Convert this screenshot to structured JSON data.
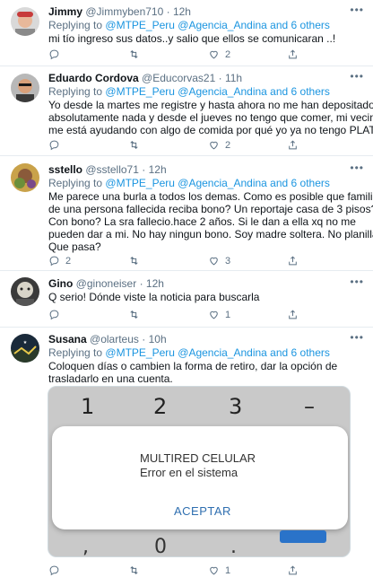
{
  "colors": {
    "link": "#1b95e0",
    "secondary_text": "#5b7083",
    "divider": "#e6ecf0",
    "dialog_button": "#2f6fb0"
  },
  "tweets": [
    {
      "name": "Jimmy",
      "handle": "@Jimmyben710",
      "time": "12h",
      "replying_prefix": "Replying to",
      "replying_links": "@MTPE_Peru @Agencia_Andina and 6 others",
      "text_lines": [
        "mi tío ingreso sus datos..y salio que ellos se comunicaran  ..!"
      ],
      "counts": {
        "reply": "",
        "retweet": "",
        "like": "2"
      }
    },
    {
      "name": "Eduardo Cordova",
      "handle": "@Educorvas21",
      "time": "11h",
      "replying_prefix": "Replying to",
      "replying_links": "@MTPE_Peru @Agencia_Andina and 6 others",
      "text_lines": [
        "Yo desde la martes me registre y hasta ahora no me han depositado",
        "absolutamente nada y desde el jueves no tengo que comer, mi vecino",
        "me está ayudando con algo de comida por qué yo ya no tengo PLATA"
      ],
      "counts": {
        "reply": "",
        "retweet": "",
        "like": "2"
      }
    },
    {
      "name": "sstello",
      "handle": "@sstello71",
      "time": "12h",
      "replying_prefix": "Replying to",
      "replying_links": "@MTPE_Peru @Agencia_Andina and 6 others",
      "text_lines": [
        "Me parece una burla a todos los demas. Como es posible que familiar",
        "de una persona fallecida reciba bono? Un reportaje casa de 3 pisos?",
        "Con bono? La sra fallecio.hace 2 años. Si le dan a ella xq no me",
        "pueden dar a mi. No hay ningun bono. Soy madre soltera. No planilla.",
        "Que pasa?"
      ],
      "counts": {
        "reply": "2",
        "retweet": "",
        "like": "3"
      }
    },
    {
      "name": "Gino",
      "handle": "@ginoneiser",
      "time": "12h",
      "replying_prefix": "",
      "replying_links": "",
      "text_lines": [
        "Q serio! Dónde viste la noticia para buscarla"
      ],
      "counts": {
        "reply": "",
        "retweet": "",
        "like": "1"
      }
    },
    {
      "name": "Susana",
      "handle": "@olarteus",
      "time": "10h",
      "replying_prefix": "Replying to",
      "replying_links": "@MTPE_Peru @Agencia_Andina and 6 others",
      "text_lines": [
        "Coloquen días o cambien la forma de retiro, dar la opción de",
        "trasladarlo en una cuenta."
      ],
      "counts": {
        "reply": "",
        "retweet": "",
        "like": "1"
      }
    }
  ],
  "media": {
    "keys_top": [
      "1",
      "2",
      "3",
      "–"
    ],
    "dialog_title": "MULTIRED CELULAR",
    "dialog_message": "Error en el sistema",
    "dialog_button": "ACEPTAR",
    "keys_bottom": [
      ",",
      "0",
      "."
    ]
  }
}
